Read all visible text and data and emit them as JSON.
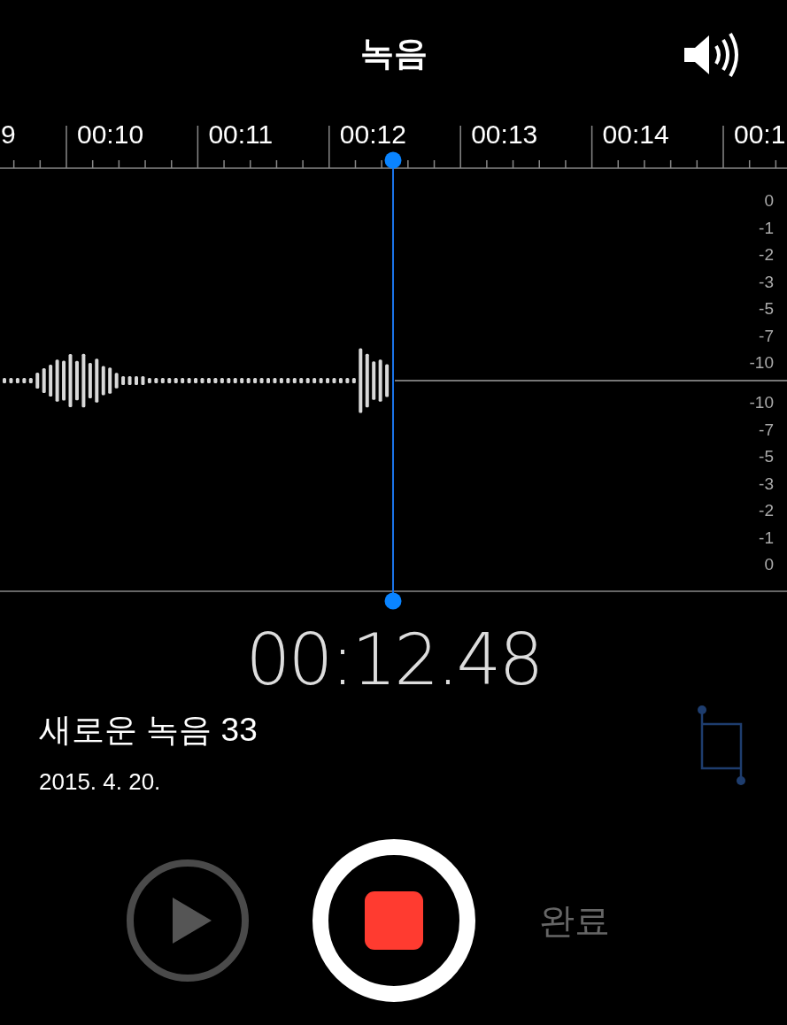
{
  "title": "녹음",
  "timeline": {
    "ticks": [
      "9",
      "00:10",
      "00:11",
      "00:12",
      "00:13",
      "00:14",
      "00:1"
    ]
  },
  "db_scale": {
    "upper": [
      "0",
      "-1",
      "-2",
      "-3",
      "-5",
      "-7",
      "-10"
    ],
    "lower": [
      "-10",
      "-7",
      "-5",
      "-3",
      "-2",
      "-1",
      "0"
    ]
  },
  "elapsed": "00:12.48",
  "recording": {
    "name": "새로운 녹음 33",
    "date": "2015. 4. 20."
  },
  "controls": {
    "recording": true,
    "done": "완료"
  }
}
